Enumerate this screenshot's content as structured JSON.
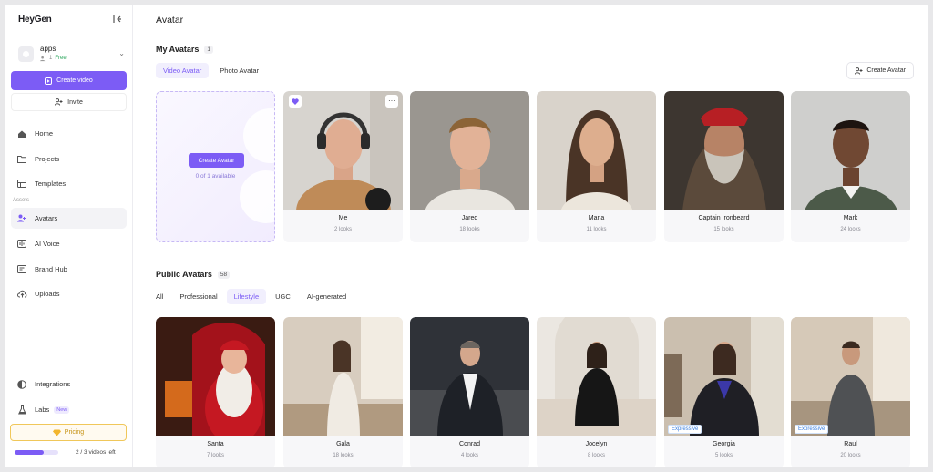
{
  "sidebar": {
    "logo": "HeyGen",
    "workspace": {
      "name": "apps",
      "members": "1",
      "plan": "Free"
    },
    "create_video": "Create video",
    "invite": "Invite",
    "nav": [
      {
        "label": "Home",
        "icon": "home-icon"
      },
      {
        "label": "Projects",
        "icon": "folder-icon"
      },
      {
        "label": "Templates",
        "icon": "templates-icon"
      }
    ],
    "assets_label": "Assets",
    "assets": [
      {
        "label": "Avatars",
        "icon": "avatar-icon"
      },
      {
        "label": "AI Voice",
        "icon": "voice-icon"
      },
      {
        "label": "Brand Hub",
        "icon": "brand-icon"
      },
      {
        "label": "Uploads",
        "icon": "upload-icon"
      }
    ],
    "integrations": "Integrations",
    "labs": "Labs",
    "labs_badge": "New",
    "pricing": "Pricing",
    "usage": {
      "used": 2,
      "total": 3,
      "text": "2 / 3 videos left"
    }
  },
  "main": {
    "title": "Avatar",
    "my_avatars": {
      "title": "My Avatars",
      "count": "1",
      "tabs": [
        "Video Avatar",
        "Photo Avatar"
      ],
      "create_button": "Create Avatar",
      "placeholder_button": "Create Avatar",
      "placeholder_sub": "0 of 1 available",
      "cards": [
        {
          "name": "Me",
          "looks": "2 looks"
        },
        {
          "name": "Jared",
          "looks": "18 looks"
        },
        {
          "name": "Maria",
          "looks": "11 looks"
        },
        {
          "name": "Captain Ironbeard",
          "looks": "15 looks"
        },
        {
          "name": "Mark",
          "looks": "24 looks"
        }
      ]
    },
    "public_avatars": {
      "title": "Public Avatars",
      "count": "58",
      "tabs": [
        "All",
        "Professional",
        "Lifestyle",
        "UGC",
        "AI-generated"
      ],
      "cards": [
        {
          "name": "Santa",
          "looks": "7 looks"
        },
        {
          "name": "Gala",
          "looks": "18 looks"
        },
        {
          "name": "Conrad",
          "looks": "4 looks"
        },
        {
          "name": "Jocelyn",
          "looks": "8 looks"
        },
        {
          "name": "Georgia",
          "looks": "5 looks",
          "tag": "Expressive"
        },
        {
          "name": "Raul",
          "looks": "20 looks",
          "tag": "Expressive"
        }
      ]
    }
  },
  "colors": {
    "accent": "#7c5cf5",
    "pricing": "#c69214",
    "free": "#2aa55b"
  }
}
